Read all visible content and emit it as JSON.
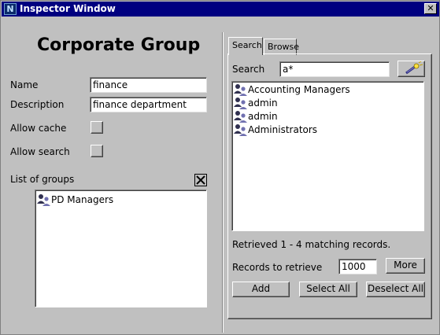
{
  "window": {
    "title": "Inspector Window",
    "title_icon_letter": "N",
    "close_label": "✕"
  },
  "left": {
    "heading": "Corporate Group",
    "name_label": "Name",
    "name_value": "finance",
    "description_label": "Description",
    "description_value": "finance department",
    "allow_cache_label": "Allow cache",
    "allow_search_label": "Allow search",
    "list_label": "List of groups",
    "groups": [
      {
        "name": "PD Managers"
      }
    ]
  },
  "right": {
    "tabs": [
      {
        "label": "Search",
        "active": true
      },
      {
        "label": "Browse",
        "active": false
      }
    ],
    "search_label": "Search",
    "search_value": "a*",
    "results": [
      {
        "name": "Accounting Managers"
      },
      {
        "name": "admin"
      },
      {
        "name": "admin"
      },
      {
        "name": "Administrators"
      }
    ],
    "status": "Retrieved 1 - 4 matching records.",
    "records_label": "Records to retrieve",
    "records_value": "1000",
    "more_label": "More",
    "add_label": "Add",
    "select_all_label": "Select All",
    "deselect_all_label": "Deselect All"
  }
}
